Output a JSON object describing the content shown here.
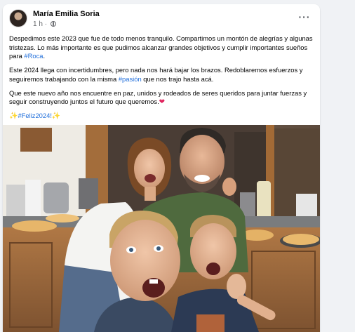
{
  "post": {
    "author_name": "María Emilia Soria",
    "time_ago": "1 h",
    "privacy_icon": "globe-icon",
    "more_icon": "more-options-icon",
    "paragraphs": [
      [
        {
          "text": "Despedimos este 2023 que fue de todo menos tranquilo. Compartimos un montón de alegrías y algunas tristezas. Lo más importante es que pudimos alcanzar grandes objetivos y cumplir importantes sueños para "
        },
        {
          "text": "#Roca",
          "type": "hashtag"
        },
        {
          "text": "."
        }
      ],
      [
        {
          "text": "Este 2024 llega con incertidumbres, pero nada nos hará bajar los brazos. Redoblaremos esfuerzos y seguiremos trabajando con la misma "
        },
        {
          "text": "#pasión",
          "type": "hashtag"
        },
        {
          "text": " que nos trajo hasta acá."
        }
      ],
      [
        {
          "text": "Que este nuevo año nos encuentre en paz, unidos y rodeados de seres queridos para juntar fuerzas y seguir construyendo juntos el futuro que queremos."
        },
        {
          "text": "❤",
          "type": "emoji",
          "name": "heart"
        }
      ],
      [
        {
          "text": "✨",
          "type": "emoji",
          "name": "sparkles"
        },
        {
          "text": "#Feliz2024!",
          "type": "hashtag"
        },
        {
          "text": "✨",
          "type": "emoji",
          "name": "sparkles"
        }
      ]
    ],
    "photo_description_icon": "family-kitchen-photo"
  },
  "colors": {
    "background": "#f0f2f5",
    "card": "#ffffff",
    "text": "#050505",
    "secondary_text": "#65676b",
    "link": "#216fdb",
    "heart": "#e0245e"
  }
}
